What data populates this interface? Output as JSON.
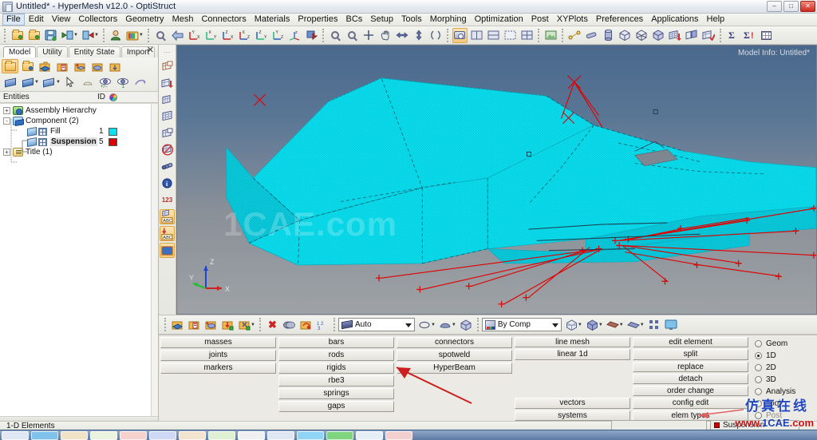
{
  "window": {
    "title": "Untitled* - HyperMesh v12.0 - OptiStruct",
    "app_icon": "hypermesh-icon",
    "minimize": "–",
    "maximize": "□",
    "close": "✕"
  },
  "menubar": {
    "items": [
      {
        "label": "File"
      },
      {
        "label": "Edit"
      },
      {
        "label": "View"
      },
      {
        "label": "Collectors"
      },
      {
        "label": "Geometry"
      },
      {
        "label": "Mesh"
      },
      {
        "label": "Connectors"
      },
      {
        "label": "Materials"
      },
      {
        "label": "Properties"
      },
      {
        "label": "BCs"
      },
      {
        "label": "Setup"
      },
      {
        "label": "Tools"
      },
      {
        "label": "Morphing"
      },
      {
        "label": "Optimization"
      },
      {
        "label": "Post"
      },
      {
        "label": "XYPlots"
      },
      {
        "label": "Preferences"
      },
      {
        "label": "Applications"
      },
      {
        "label": "Help"
      }
    ]
  },
  "toolbar": {
    "groups": [
      {
        "icons": [
          "new-model-icon",
          "open-model-icon",
          "save-model-icon",
          "import-icon",
          "export-icon"
        ]
      },
      {
        "icons": [
          "user-profile-icon",
          "load-userprofile-icon"
        ]
      },
      {
        "icons": [
          "fit-view-icon",
          "previous-view-icon",
          "view-xy-icon",
          "view-yx-icon",
          "view-zx-icon",
          "view-xz-icon",
          "view-zy-icon",
          "view-yz-icon",
          "isometric-view-icon",
          "rotate-view-icon"
        ]
      },
      {
        "icons": [
          "zoom-in-icon",
          "zoom-window-icon",
          "center-icon",
          "pan-icon",
          "arrow-left-right-icon",
          "arrow-up-down-icon",
          "rotate-free-icon"
        ]
      },
      {
        "icons": [
          "single-window-icon",
          "two-window-icon",
          "stacked-window-icon",
          "dashed-window-icon",
          "four-window-icon"
        ]
      },
      {
        "icons": [
          "image-capture-icon"
        ]
      },
      {
        "icons": [
          "connector-icon",
          "weld-icon",
          "cylinder-icon",
          "solid-box-icon",
          "wireframe-box-icon",
          "shaded-box-icon",
          "mesh-red-icon",
          "mesh-blue-icon",
          "mesh-check-icon"
        ]
      },
      {
        "icons": [
          "summary-sigma-icon",
          "summary-sigma-alert-icon",
          "matrix-browser-icon"
        ]
      }
    ]
  },
  "left_panel": {
    "tabs": [
      {
        "label": "Model",
        "selected": true
      },
      {
        "label": "Utility",
        "selected": false
      },
      {
        "label": "Entity State",
        "selected": false
      },
      {
        "label": "Import",
        "selected": false
      }
    ],
    "close_label": "✕",
    "tool_rows": [
      {
        "icons": [
          "folder-blank-icon",
          "assembly-folder-icon",
          "component-folder-icon",
          "delete-folder-icon",
          "property-folder-icon",
          "material-folder-icon",
          "load-folder-icon"
        ]
      },
      {
        "icons": [
          "show-all-icon",
          "isolate-icon",
          "isolate-only-icon",
          "cursor-pick-icon",
          "mask-icon",
          "display-plus-minus-icon",
          "display-1-icon",
          "reverse-icon"
        ]
      }
    ],
    "header": {
      "entities_label": "Entities",
      "id_label": "ID",
      "color_label": "color-wheel-icon"
    },
    "tree": [
      {
        "label": "Assembly Hierarchy",
        "expander": "+",
        "indent": 0,
        "icon": "assembly-icon",
        "id": "",
        "color": "",
        "bold": false
      },
      {
        "label": "Component (2)",
        "expander": "-",
        "indent": 0,
        "icon": "component-icon",
        "id": "",
        "color": "",
        "bold": false
      },
      {
        "label": "Fill",
        "expander": "",
        "indent": 2,
        "icon": "component-mesh-icon",
        "id": "1",
        "color": "#00e5f0",
        "bold": false
      },
      {
        "label": "Suspension",
        "expander": "",
        "indent": 2,
        "icon": "component-mesh-icon",
        "id": "5",
        "color": "#dd0000",
        "bold": true
      },
      {
        "label": "Title (1)",
        "expander": "+",
        "indent": 0,
        "icon": "title-icon",
        "id": "",
        "color": "",
        "bold": false
      }
    ]
  },
  "vertical_toolbar": {
    "icons": [
      "mesh-window-icon",
      "mesh-red-arrow-icon",
      "mesh-small-icon",
      "mesh-plain-icon",
      "mesh-window2-icon",
      "mesh-no-display-icon",
      "elements-icon",
      "info-icon",
      "numbers-123-icon",
      "mesh-abc-icon",
      "load-abc-icon",
      "box-select-icon"
    ]
  },
  "viewport": {
    "model_info": "Model Info: Untitled*",
    "watermark": "1CAE.com",
    "axis": {
      "x": "X",
      "y": "Y",
      "z": "Z"
    },
    "colors": {
      "mesh": "#00e5f0",
      "rigids": "#dd0000",
      "bg_top": "#49688c",
      "bg_bottom": "#9ea2a6"
    }
  },
  "view_toolbar": {
    "icons_left": [
      "component-folder-icon",
      "plate-blue-icon",
      "property-icon",
      "material-icon",
      "load-down-icon",
      "constraint-icon"
    ],
    "icons_mid": [
      "delete-icon",
      "mask-icon",
      "reverse-mask-icon",
      "numbering-icon"
    ],
    "mode_combo": {
      "value": "Auto",
      "icon": "shaded-plate-icon"
    },
    "icons_shade": [
      "wire-geom-icon",
      "shaded-geom-icon",
      "solid-geom-icon"
    ],
    "color_combo": {
      "value": "By Comp",
      "icon": "color-cube-icon"
    },
    "icons_right": [
      "wireframe-elems-icon",
      "shaded-elems-icon",
      "feature-lines-icon",
      "shaded-surface-icon",
      "exploded-icon",
      "screen-icon"
    ]
  },
  "command_panel": {
    "columns": [
      {
        "buttons": [
          "masses",
          "joints",
          "markers"
        ]
      },
      {
        "buttons": [
          "bars",
          "rods",
          "rigids",
          "rbe3",
          "springs",
          "gaps"
        ]
      },
      {
        "buttons": [
          "connectors",
          "spotweld",
          "HyperBeam"
        ]
      },
      {
        "buttons": [
          "line mesh",
          "linear 1d",
          "",
          "",
          "",
          "vectors",
          "systems"
        ]
      },
      {
        "buttons": [
          "edit element",
          "split",
          "replace",
          "detach",
          "order change",
          "config edit",
          "elem types"
        ]
      }
    ],
    "radios": [
      {
        "label": "Geom",
        "selected": false,
        "dim": false
      },
      {
        "label": "1D",
        "selected": true,
        "dim": false
      },
      {
        "label": "2D",
        "selected": false,
        "dim": false
      },
      {
        "label": "3D",
        "selected": false,
        "dim": false
      },
      {
        "label": "Analysis",
        "selected": false,
        "dim": false
      },
      {
        "label": "Tool",
        "selected": false,
        "dim": false
      },
      {
        "label": "Post",
        "selected": false,
        "dim": true
      }
    ]
  },
  "statusbar": {
    "text": "1-D Elements",
    "input_value": "",
    "component": "Suspension",
    "component_color": "#cc0000"
  },
  "watermark": {
    "chinese": "仿真在线",
    "url_red": "www.",
    "url_blue": "1CAE",
    "url_red2": ".com"
  }
}
